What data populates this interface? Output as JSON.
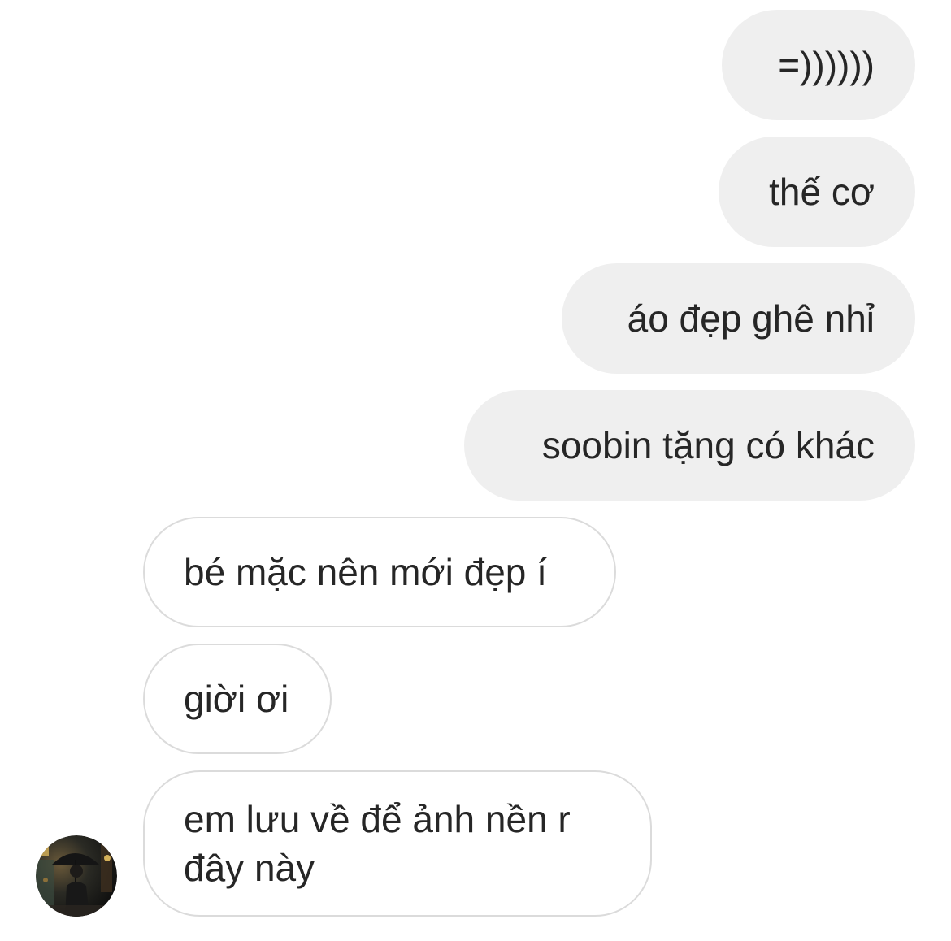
{
  "conversation": {
    "messages": [
      {
        "direction": "sent",
        "text": "=))))))"
      },
      {
        "direction": "sent",
        "text": "thế cơ"
      },
      {
        "direction": "sent",
        "text": "áo đẹp ghê nhỉ"
      },
      {
        "direction": "sent",
        "text": "soobin tặng có khác"
      },
      {
        "direction": "received",
        "text": "bé mặc nên mới đẹp í"
      },
      {
        "direction": "received",
        "text": "giời ơi"
      },
      {
        "direction": "received",
        "text": "em lưu về để ảnh nền r đây này"
      }
    ],
    "contact_avatar": {
      "icon": "avatar-photo-person-with-umbrella-at-night"
    }
  },
  "colors": {
    "sent_bubble": "#efefef",
    "received_bubble_border": "#dbdbdb",
    "text": "#262626",
    "background": "#ffffff"
  }
}
